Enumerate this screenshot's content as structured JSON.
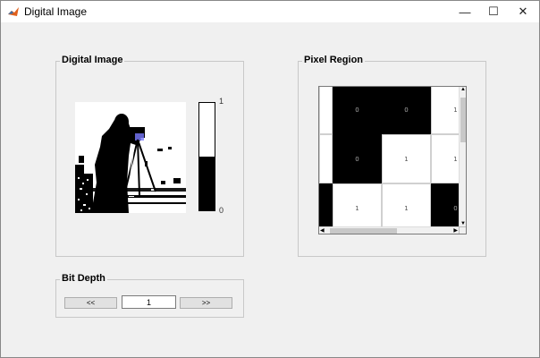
{
  "window": {
    "title": "Digital Image",
    "minimize": "—",
    "maximize": "☐",
    "close": "✕"
  },
  "digital_panel": {
    "title": "Digital Image",
    "colorbar_max": "1",
    "colorbar_min": "0"
  },
  "pixel_panel": {
    "title": "Pixel Region",
    "cells": [
      {
        "value": "0",
        "color": "black"
      },
      {
        "value": "0",
        "color": "black"
      },
      {
        "value": "1",
        "color": "white"
      },
      {
        "value": "0",
        "color": "black"
      },
      {
        "value": "1",
        "color": "white"
      },
      {
        "value": "1",
        "color": "white"
      },
      {
        "value": "1",
        "color": "white"
      },
      {
        "value": "1",
        "color": "white"
      },
      {
        "value": "0",
        "color": "black"
      }
    ]
  },
  "bit_depth": {
    "title": "Bit Depth",
    "prev_label": "<<",
    "value": "1",
    "next_label": ">>"
  }
}
